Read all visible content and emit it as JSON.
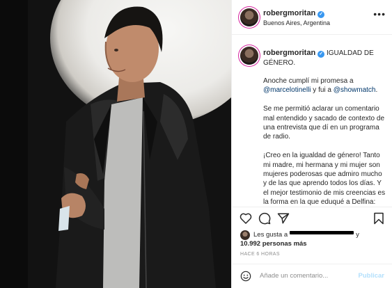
{
  "post": {
    "username": "robergmoritan",
    "verified": true,
    "location": "Buenos Aires, Argentina",
    "caption_title": "IGUALDAD DE GÉNERO.",
    "caption_line1_pre": "Anoche cumplí mi promesa a",
    "mention_1": "@marcelotinelli",
    "caption_line1_mid": " y fui a ",
    "mention_2": "@showmatch",
    "caption_line1_post": ".",
    "caption_p2": "Se me permitió aclarar un comentario mal entendido y sacado de contexto de una entrevista que dí en un programa de radio.",
    "caption_p3": "¡Creo en la igualdad de género! Tanto mi madre, mi hermana y mi mujer son mujeres poderosas que admiro mucho y de las que aprendo todos los días. Y el mejor testimonio de mis creencias es la forma en la que eduqué a Delfina: independiente y libre siempre.",
    "likes_prefix": "Les gusta a",
    "likes_suffix": "y",
    "likes_count": "10.992 personas más",
    "time_ago": "HACE 6 HORAS",
    "comment_placeholder": "Añade un comentario...",
    "publish_label": "Publicar"
  },
  "icons": {
    "more": "more-options-icon",
    "like": "heart-icon",
    "comment": "comment-icon",
    "share": "share-icon",
    "save": "bookmark-icon",
    "emoji": "emoji-icon"
  },
  "colors": {
    "verified_blue": "#3897f0",
    "mention_blue": "#00376b",
    "publish_disabled": "#b2dffc",
    "muted": "#8e8e8e"
  }
}
